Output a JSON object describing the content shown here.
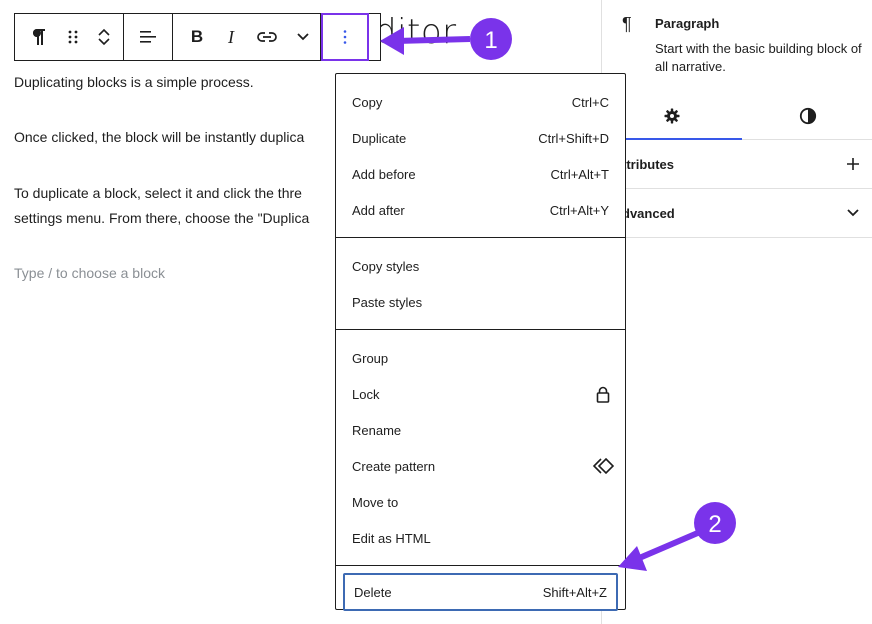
{
  "editor": {
    "heading_fragment": "ditor",
    "paragraphs": [
      "Duplicating blocks is a simple process.",
      "Once clicked, the block will be instantly duplica",
      "To duplicate a block, select it and click the thre",
      "settings menu. From there, choose the \"Duplica"
    ],
    "placeholder": "Type / to choose a block"
  },
  "toolbar": {
    "icons": [
      "paragraph-icon",
      "drag-handle-icon",
      "move-up-down-icon",
      "align-icon",
      "bold-icon",
      "italic-icon",
      "link-icon",
      "more-rich-text-icon",
      "options-icon"
    ],
    "bold_label": "B",
    "italic_label": "I"
  },
  "sidebar": {
    "block_icon": "¶",
    "block_title": "Paragraph",
    "block_description": "Start with the basic building block of all narrative.",
    "tabs": [
      {
        "icon": "gear-icon",
        "active": true
      },
      {
        "icon": "styles-icon",
        "active": false
      }
    ],
    "panels": [
      {
        "label": "ttributes",
        "icon": "plus-icon"
      },
      {
        "label": "dvanced",
        "icon": "chevron-down-icon"
      }
    ]
  },
  "menu": {
    "groups": [
      [
        {
          "label": "Copy",
          "shortcut": "Ctrl+C"
        },
        {
          "label": "Duplicate",
          "shortcut": "Ctrl+Shift+D"
        },
        {
          "label": "Add before",
          "shortcut": "Ctrl+Alt+T"
        },
        {
          "label": "Add after",
          "shortcut": "Ctrl+Alt+Y"
        }
      ],
      [
        {
          "label": "Copy styles",
          "shortcut": ""
        },
        {
          "label": "Paste styles",
          "shortcut": ""
        }
      ],
      [
        {
          "label": "Group",
          "shortcut": ""
        },
        {
          "label": "Lock",
          "icon": "lock-icon"
        },
        {
          "label": "Rename",
          "shortcut": ""
        },
        {
          "label": "Create pattern",
          "icon": "pattern-icon"
        },
        {
          "label": "Move to",
          "shortcut": ""
        },
        {
          "label": "Edit as HTML",
          "shortcut": ""
        }
      ],
      [
        {
          "label": "Delete",
          "shortcut": "Shift+Alt+Z"
        }
      ]
    ]
  },
  "annotations": {
    "step1": "1",
    "step2": "2",
    "color": "#7a33ea"
  },
  "colors": {
    "accent": "#3858e9",
    "annotation": "#7a33ea",
    "delete_focus": "#3d6ab3"
  }
}
